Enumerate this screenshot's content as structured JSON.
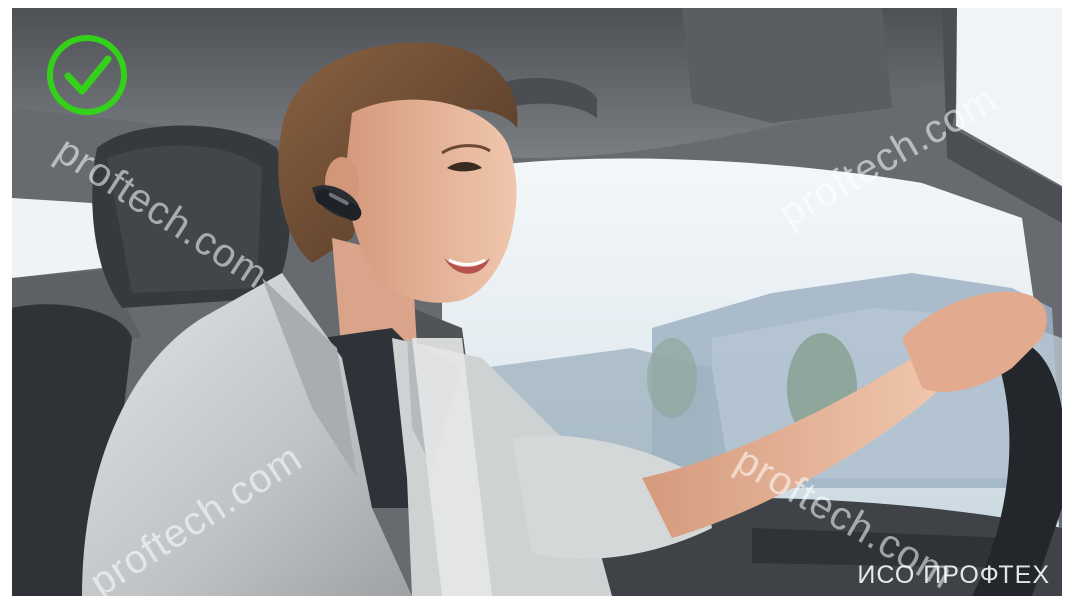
{
  "photo": {
    "subject": "woman-driving-with-bluetooth-headset",
    "colors": {
      "sky": "#e8eef2",
      "interior": "#5e6266",
      "jacket": "#c9ccce",
      "skin": "#e7b79a",
      "hair": "#6b4a33",
      "headset": "#2a2d31",
      "check": "#34d11a"
    }
  },
  "badge": {
    "icon": "checkmark-circle-icon"
  },
  "watermarks": [
    "proftech.com",
    "proftech.com",
    "proftech.com",
    "proftech.com"
  ],
  "brand_mark": "ИСО ПРОФТЕХ"
}
